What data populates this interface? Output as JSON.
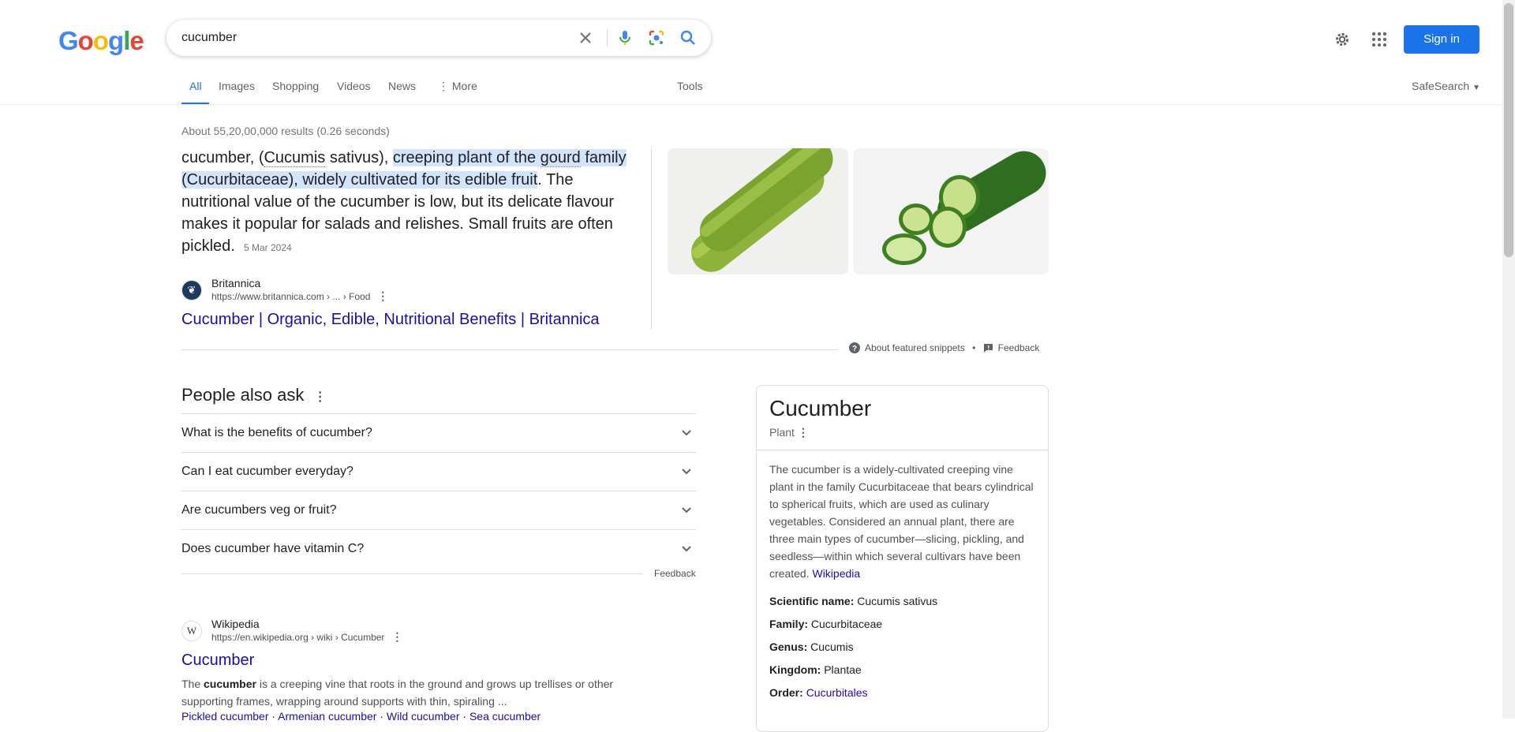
{
  "header": {
    "logo": "Google",
    "search_value": "cucumber",
    "sign_in": "Sign in"
  },
  "tabs": {
    "items": [
      "All",
      "Images",
      "Shopping",
      "Videos",
      "News",
      "More"
    ],
    "tools": "Tools",
    "safesearch": "SafeSearch"
  },
  "results": {
    "stats": "About 55,20,00,000 results (0.26 seconds)",
    "snippet": {
      "p1": "cucumber, (",
      "p2": "Cucumis",
      "p3": " sativus), ",
      "hl1": "creeping plant of the ",
      "hl2": "gourd",
      "hl3": " family (Cucurbitaceae), widely cultivated for its edible fruit",
      "rest": ". The nutritional value of the cucumber is low, but its delicate flavour makes it popular for salads and relishes. Small fruits are often pickled.",
      "date": "5 Mar 2024",
      "source_name": "Britannica",
      "source_url": "https://www.britannica.com › ... › Food",
      "title": "Cucumber | Organic, Edible, Nutritional Benefits | Britannica",
      "about": "About featured snippets",
      "feedback": "Feedback"
    },
    "paa": {
      "title": "People also ask",
      "questions": [
        "What is the benefits of cucumber?",
        "Can I eat cucumber everyday?",
        "Are cucumbers veg or fruit?",
        "Does cucumber have vitamin C?"
      ],
      "feedback": "Feedback"
    },
    "wiki": {
      "source_name": "Wikipedia",
      "source_url": "https://en.wikipedia.org › wiki › Cucumber",
      "title": "Cucumber",
      "desc_pre": "The ",
      "desc_bold": "cucumber",
      "desc_post": " is a creeping vine that roots in the ground and grows up trellises or other supporting frames, wrapping around supports with thin, spiraling ...",
      "links": [
        "Pickled cucumber",
        "Armenian cucumber",
        "Wild cucumber",
        "Sea cucumber"
      ]
    }
  },
  "knowledge_panel": {
    "title": "Cucumber",
    "subtitle": "Plant",
    "description": "The cucumber is a widely-cultivated creeping vine plant in the family Cucurbitaceae that bears cylindrical to spherical fruits, which are used as culinary vegetables. Considered an annual plant, there are three main types of cucumber—slicing, pickling, and seedless—within which several cultivars have been created.",
    "desc_link": "Wikipedia",
    "facts": [
      {
        "label": "Scientific name:",
        "value": "Cucumis sativus"
      },
      {
        "label": "Family:",
        "value": "Cucurbitaceae"
      },
      {
        "label": "Genus:",
        "value": "Cucumis"
      },
      {
        "label": "Kingdom:",
        "value": "Plantae"
      },
      {
        "label": "Order:",
        "value": "Cucurbitales"
      }
    ]
  },
  "icons": [
    "clear-icon",
    "microphone-icon",
    "lens-icon",
    "search-icon",
    "gear-icon",
    "apps-icon",
    "kebab-icon",
    "chevron-down-icon",
    "help-icon",
    "feedback-icon"
  ],
  "colors": {
    "accent": "#1a73e8",
    "link": "#1a0dab",
    "highlight": "#d2e3fc"
  }
}
